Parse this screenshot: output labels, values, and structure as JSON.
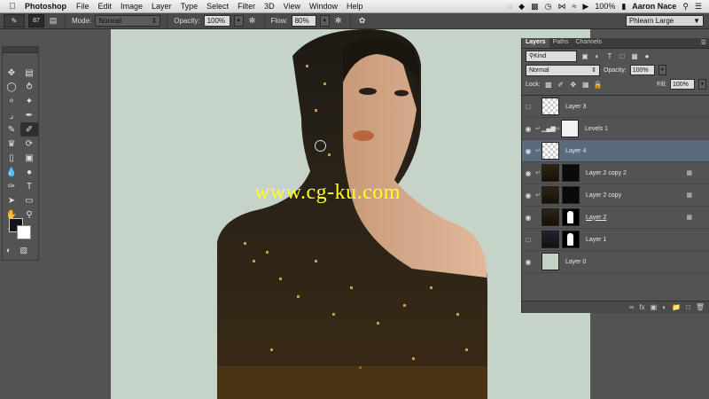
{
  "menubar": {
    "app": "Photoshop",
    "items": [
      "File",
      "Edit",
      "Image",
      "Layer",
      "Type",
      "Select",
      "Filter",
      "3D",
      "View",
      "Window",
      "Help"
    ],
    "battery": "100%",
    "user": "Aaron Nace"
  },
  "options": {
    "brush_size": "87",
    "mode_label": "Mode:",
    "mode_value": "Normal",
    "opacity_label": "Opacity:",
    "opacity_value": "100%",
    "flow_label": "Flow:",
    "flow_value": "80%",
    "workspace": "Phlearn Large"
  },
  "canvas": {
    "watermark": "www.cg-ku.com",
    "background_color": "#c5d3c9"
  },
  "layers_panel": {
    "tabs": [
      "Layers",
      "Paths",
      "Channels"
    ],
    "filter_kind": "Kind",
    "blend_mode": "Normal",
    "opacity_label": "Opacity:",
    "opacity_value": "100%",
    "lock_label": "Lock:",
    "fill_label": "Fill:",
    "fill_value": "100%",
    "layers": [
      {
        "name": "Layer 3"
      },
      {
        "name": "Levels 1"
      },
      {
        "name": "Layer 4"
      },
      {
        "name": "Layer 2 copy 2"
      },
      {
        "name": "Layer 2 copy"
      },
      {
        "name": "Layer 2"
      },
      {
        "name": "Layer 1"
      },
      {
        "name": "Layer 0"
      }
    ]
  },
  "colors": {
    "selection": "#5b6b7e",
    "panel": "#535353",
    "watermark": "#ffff1e"
  }
}
